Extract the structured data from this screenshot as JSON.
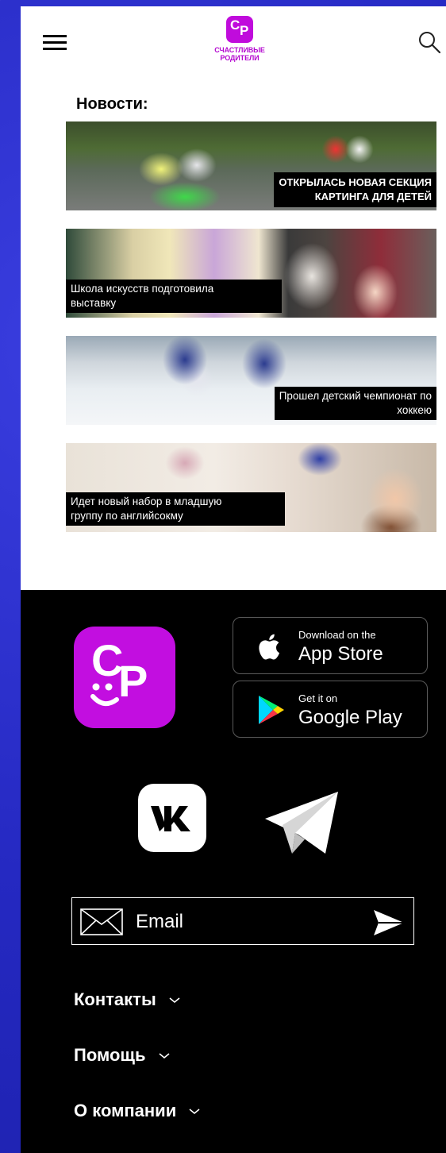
{
  "header": {
    "brand_mark_c": "С",
    "brand_mark_p": "Р",
    "brand_line1": "СЧАСТЛИВЫЕ",
    "brand_line2": "РОДИТЕЛИ",
    "brand_color": "#b40ad0"
  },
  "news": {
    "title": "Новости:",
    "items": [
      {
        "caption": "ОТКРЫЛАСЬ НОВАЯ СЕКЦИЯ\nКАРТИНГА ДЛЯ ДЕТЕЙ"
      },
      {
        "caption": "Школа искусств подготовила\nвыставку"
      },
      {
        "caption": "Прошел детский чемпионат по\nхоккею"
      },
      {
        "caption": "Идет новый набор в младшую\nгруппу по английсокму"
      }
    ]
  },
  "footer": {
    "app_logo_c": "С",
    "app_logo_p": "Р",
    "accent_color": "#c20ee0",
    "app_store": {
      "small": "Download on the",
      "big": "App Store"
    },
    "google_play": {
      "small": "Get it on",
      "big": "Google Play"
    },
    "email": {
      "placeholder": "Email"
    },
    "menu": [
      {
        "label": "Контакты"
      },
      {
        "label": "Помощь"
      },
      {
        "label": "О компании"
      }
    ]
  }
}
